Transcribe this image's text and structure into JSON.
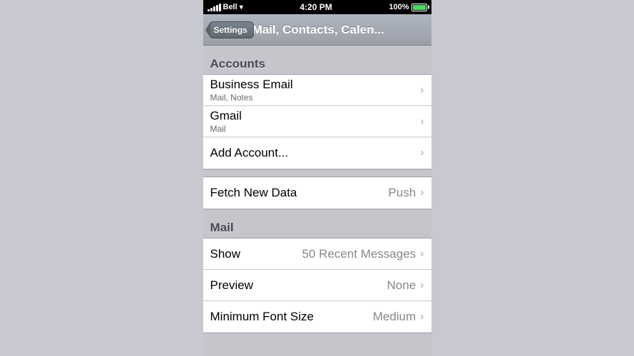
{
  "statusBar": {
    "carrier": "Bell",
    "wifi": "wifi",
    "time": "4:20 PM",
    "battery_percent": "100%"
  },
  "navBar": {
    "backLabel": "Settings",
    "title": "Mail, Contacts, Calen..."
  },
  "accounts": {
    "sectionHeader": "Accounts",
    "items": [
      {
        "label": "Business Email",
        "sublabel": "Mail, Notes"
      },
      {
        "label": "Gmail",
        "sublabel": "Mail"
      },
      {
        "label": "Add Account...",
        "sublabel": ""
      }
    ]
  },
  "fetchNewData": {
    "label": "Fetch New Data",
    "value": "Push"
  },
  "mail": {
    "sectionHeader": "Mail",
    "items": [
      {
        "label": "Show",
        "value": "50 Recent Messages"
      },
      {
        "label": "Preview",
        "value": "None"
      },
      {
        "label": "Minimum Font Size",
        "value": "Medium"
      }
    ]
  }
}
